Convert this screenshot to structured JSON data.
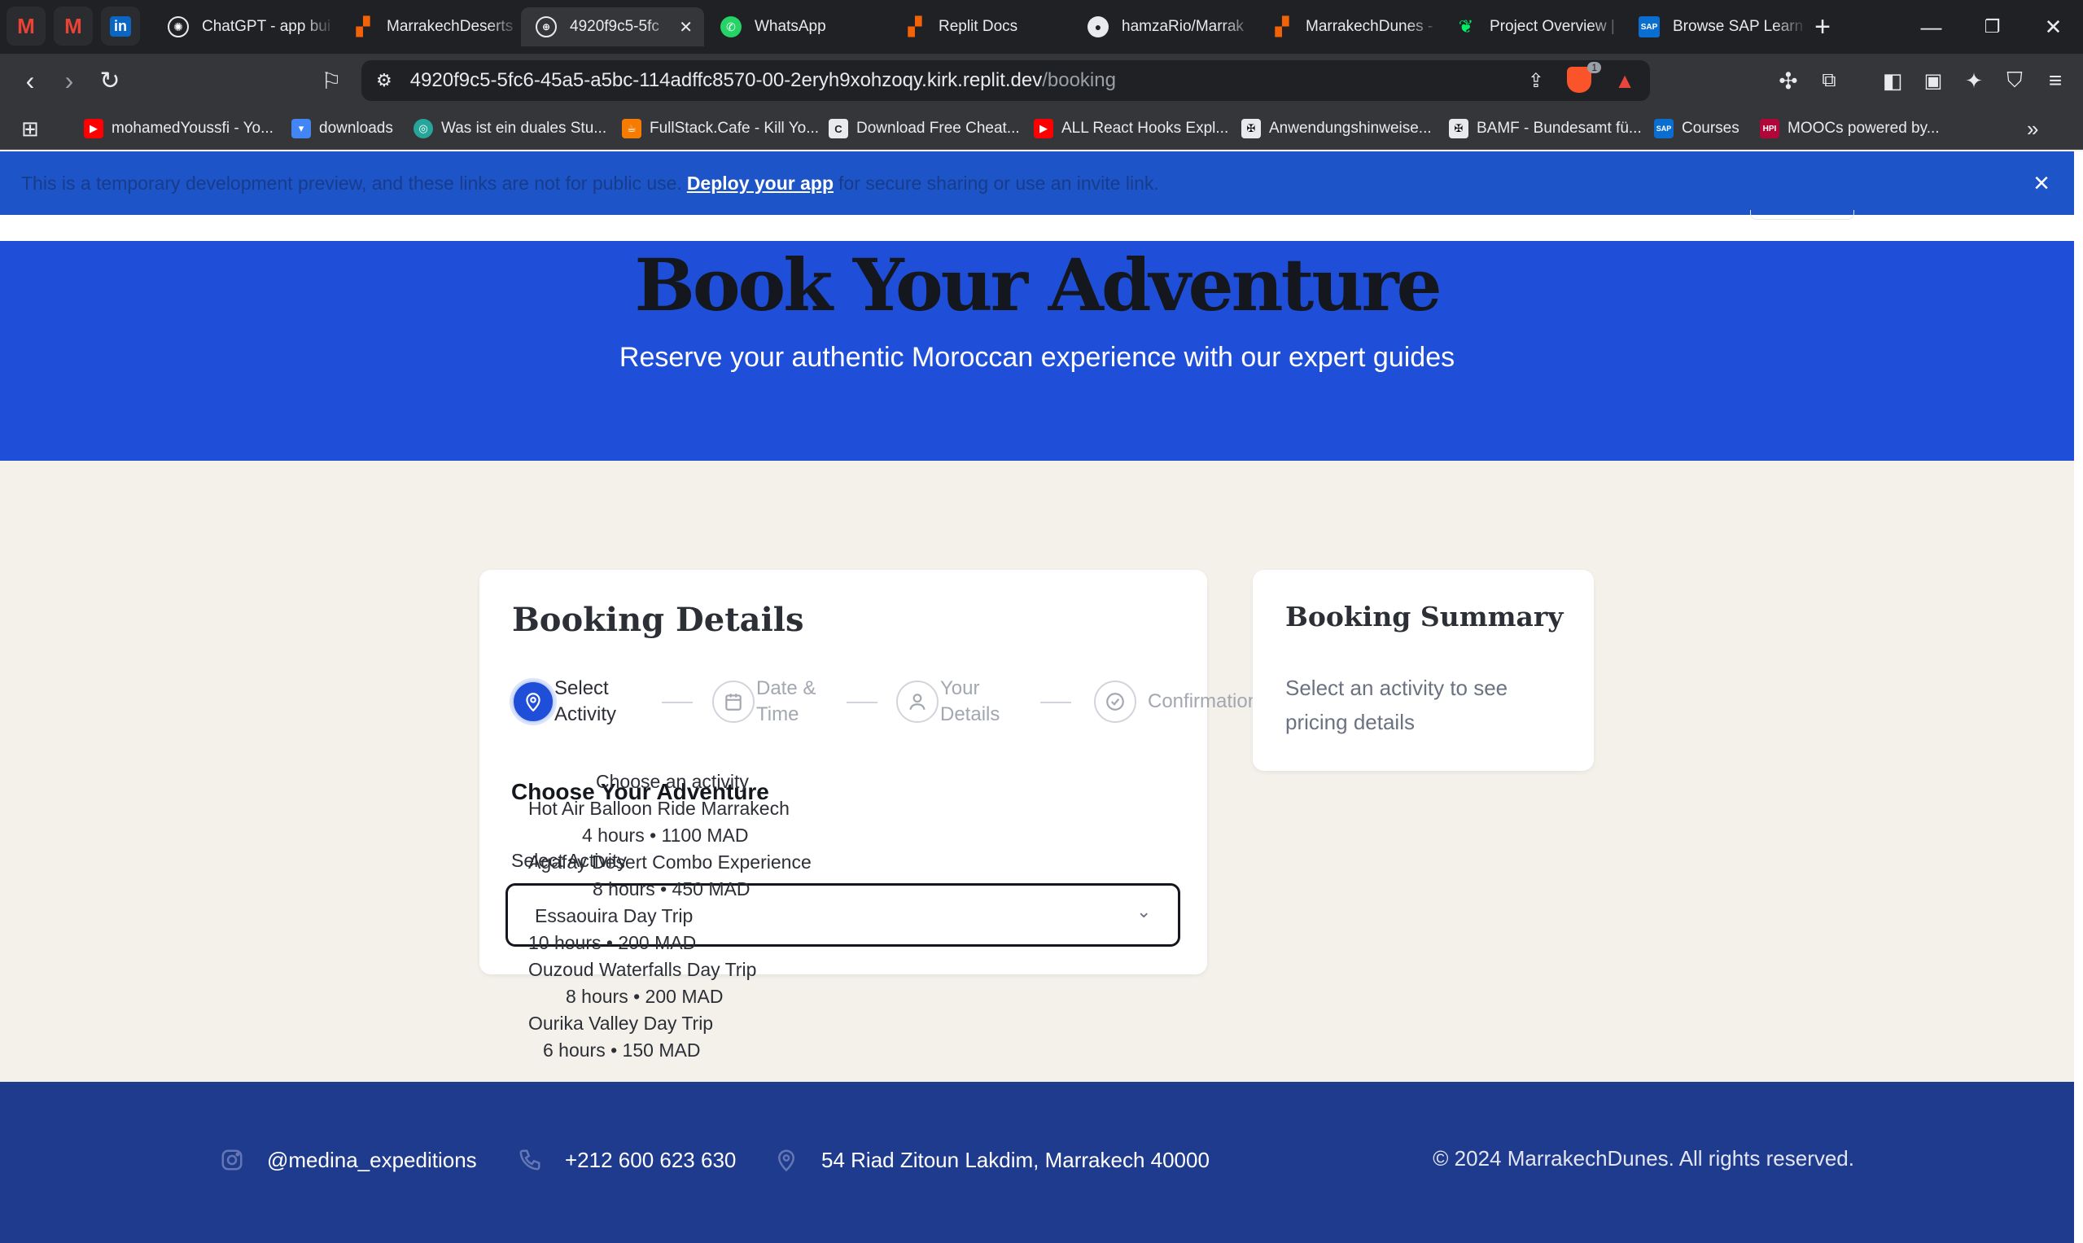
{
  "browser": {
    "pinned": [
      {
        "name": "gmail-pinned-1",
        "glyph": "M",
        "color": "#ea4335"
      },
      {
        "name": "gmail-pinned-2",
        "glyph": "M",
        "color": "#ea4335"
      },
      {
        "name": "linkedin-pinned",
        "glyph": "in",
        "color": "#0a66c2"
      }
    ],
    "tabs": [
      {
        "title": "ChatGPT - app bui",
        "icon": "chatgpt-icon",
        "color": "#e8eaed"
      },
      {
        "title": "MarrakechDeserts",
        "icon": "replit-icon",
        "color": "#f26207"
      },
      {
        "title": "4920f9c5-5fc",
        "icon": "globe-icon",
        "color": "#e8eaed",
        "active": true
      },
      {
        "title": "WhatsApp",
        "icon": "whatsapp-icon",
        "color": "#25d366"
      },
      {
        "title": "Replit Docs",
        "icon": "replit-icon",
        "color": "#f26207"
      },
      {
        "title": "hamzaRio/Marrak",
        "icon": "github-icon",
        "color": "#e8eaed"
      },
      {
        "title": "MarrakechDunes -",
        "icon": "replit-error-icon",
        "color": "#f26207"
      },
      {
        "title": "Project Overview |",
        "icon": "mongodb-icon",
        "color": "#00ed64"
      },
      {
        "title": "Browse SAP Learn",
        "icon": "sap-icon",
        "color": "#0a6ed1"
      }
    ],
    "url_host": "4920f9c5-5fc6-45a5-a5bc-114adffc8570-00-2eryh9xohzoqy.kirk.replit.dev",
    "url_path": "/booking",
    "brave_badge": "1",
    "bookmarks": [
      {
        "label": "mohamedYoussfi - Yo...",
        "icon": "youtube-icon",
        "color": "#ff0000"
      },
      {
        "label": "downloads",
        "icon": "folder-icon",
        "color": "#4285f4"
      },
      {
        "label": "Was ist ein duales Stu...",
        "icon": "globe-icon",
        "color": "#26a69a"
      },
      {
        "label": "FullStack.Cafe - Kill Yo...",
        "icon": "cafe-icon",
        "color": "#f57c00"
      },
      {
        "label": "Download Free Cheat...",
        "icon": "cheatsheet-icon",
        "color": "#202124"
      },
      {
        "label": "ALL React Hooks Expl...",
        "icon": "youtube-icon",
        "color": "#ff0000"
      },
      {
        "label": "Anwendungshinweise...",
        "icon": "eagle-icon",
        "color": "#000000"
      },
      {
        "label": "BAMF - Bundesamt fü...",
        "icon": "eagle-icon",
        "color": "#000000"
      },
      {
        "label": "Courses",
        "icon": "sap-icon",
        "color": "#0a6ed1"
      },
      {
        "label": "MOOCs powered by...",
        "icon": "hpi-icon",
        "color": "#b1063a"
      }
    ]
  },
  "page": {
    "banner": {
      "before": "This is a temporary development preview, and these links are not for public use.",
      "link": "Deploy your app",
      "after": "for secure sharing or use an invite link."
    },
    "hero": {
      "title": "Book Your Adventure",
      "subtitle": "Reserve your authentic Moroccan experience with our expert guides"
    },
    "booking": {
      "title": "Booking Details",
      "steps": [
        {
          "line1": "Select",
          "line2": "Activity",
          "icon": "map-pin-icon",
          "active": true
        },
        {
          "line1": "Date &",
          "line2": "Time",
          "icon": "calendar-icon",
          "active": false
        },
        {
          "line1": "Your",
          "line2": "Details",
          "icon": "user-icon",
          "active": false
        },
        {
          "line1": "Confirmation",
          "line2": "",
          "icon": "check-circle-icon",
          "active": false
        }
      ],
      "section_title": "Choose Your Adventure",
      "select_label": "Select Activity",
      "select_placeholder": "Choose an activity",
      "options": [
        {
          "name": "Hot Air Balloon Ride Marrakech",
          "meta": "4 hours • 1100 MAD"
        },
        {
          "name": "Agafay Desert Combo Experience",
          "meta": "8 hours • 450 MAD"
        },
        {
          "name": "Essaouira Day Trip",
          "meta": "10 hours • 200 MAD"
        },
        {
          "name": "Ouzoud Waterfalls Day Trip",
          "meta": "8 hours • 200 MAD"
        },
        {
          "name": "Ourika Valley Day Trip",
          "meta": "6 hours • 150 MAD"
        }
      ]
    },
    "summary": {
      "title": "Booking Summary",
      "text": "Select an activity to see pricing details"
    },
    "footer": {
      "instagram": "@medina_expeditions",
      "phone": "+212 600 623 630",
      "address": "54 Riad Zitoun Lakdim, Marrakech 40000",
      "copyright": "© 2024 MarrakechDunes. All rights reserved."
    }
  }
}
